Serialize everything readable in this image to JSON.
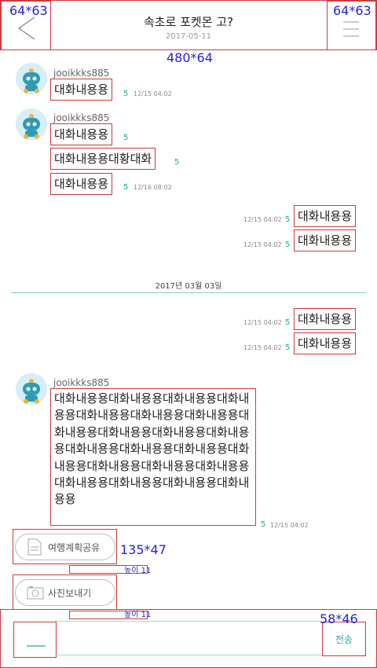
{
  "header": {
    "title": "속초로 포켓몬 고?",
    "date": "2017-05-11",
    "back_size": "64*63",
    "menu_size": "64*63",
    "header_size": "480*64"
  },
  "messages": {
    "user": "jooikkks885",
    "m1": {
      "text": "대화내용용",
      "count": "5",
      "ts": "12/15 04:02"
    },
    "m2": {
      "text": "대화내용용",
      "count": "5"
    },
    "m3": {
      "text": "대화내용용대황대화",
      "count": "5"
    },
    "m4": {
      "text": "대화내용용",
      "count": "5",
      "ts": "12/16 08:02"
    },
    "m5": {
      "text": "대화내용용",
      "count": "5",
      "ts": "12/15 04:02"
    },
    "m6": {
      "text": "대화내용용",
      "count": "5",
      "ts": "12/15 04:02"
    },
    "divider": "2017년 03월 03일",
    "m7": {
      "text": "대화내용용",
      "count": "5",
      "ts": "12/15 04:02"
    },
    "m8": {
      "text": "대화내용용",
      "count": "5",
      "ts": "12/15 04:02"
    },
    "m9": {
      "text": "대화내용용대화내용용대화내용용대화내용용대화내용용대화내용용대화내용용대화내용용대화내용용대화내용용대화내용용대화내용용대화내용용대화내용용대화내용용대화내용용대화내용용대화내용용대화내용용대화내용용대화내용용대화내용용",
      "count": "5",
      "ts": "12/15 04:02"
    }
  },
  "actions": {
    "share_label": "여행계획공유",
    "photo_label": "사진보내기",
    "btn_size": "135*47",
    "gap1": "높이 11",
    "gap2": "높이 11"
  },
  "footer": {
    "send_label": "전송",
    "send_size": "58*46"
  }
}
